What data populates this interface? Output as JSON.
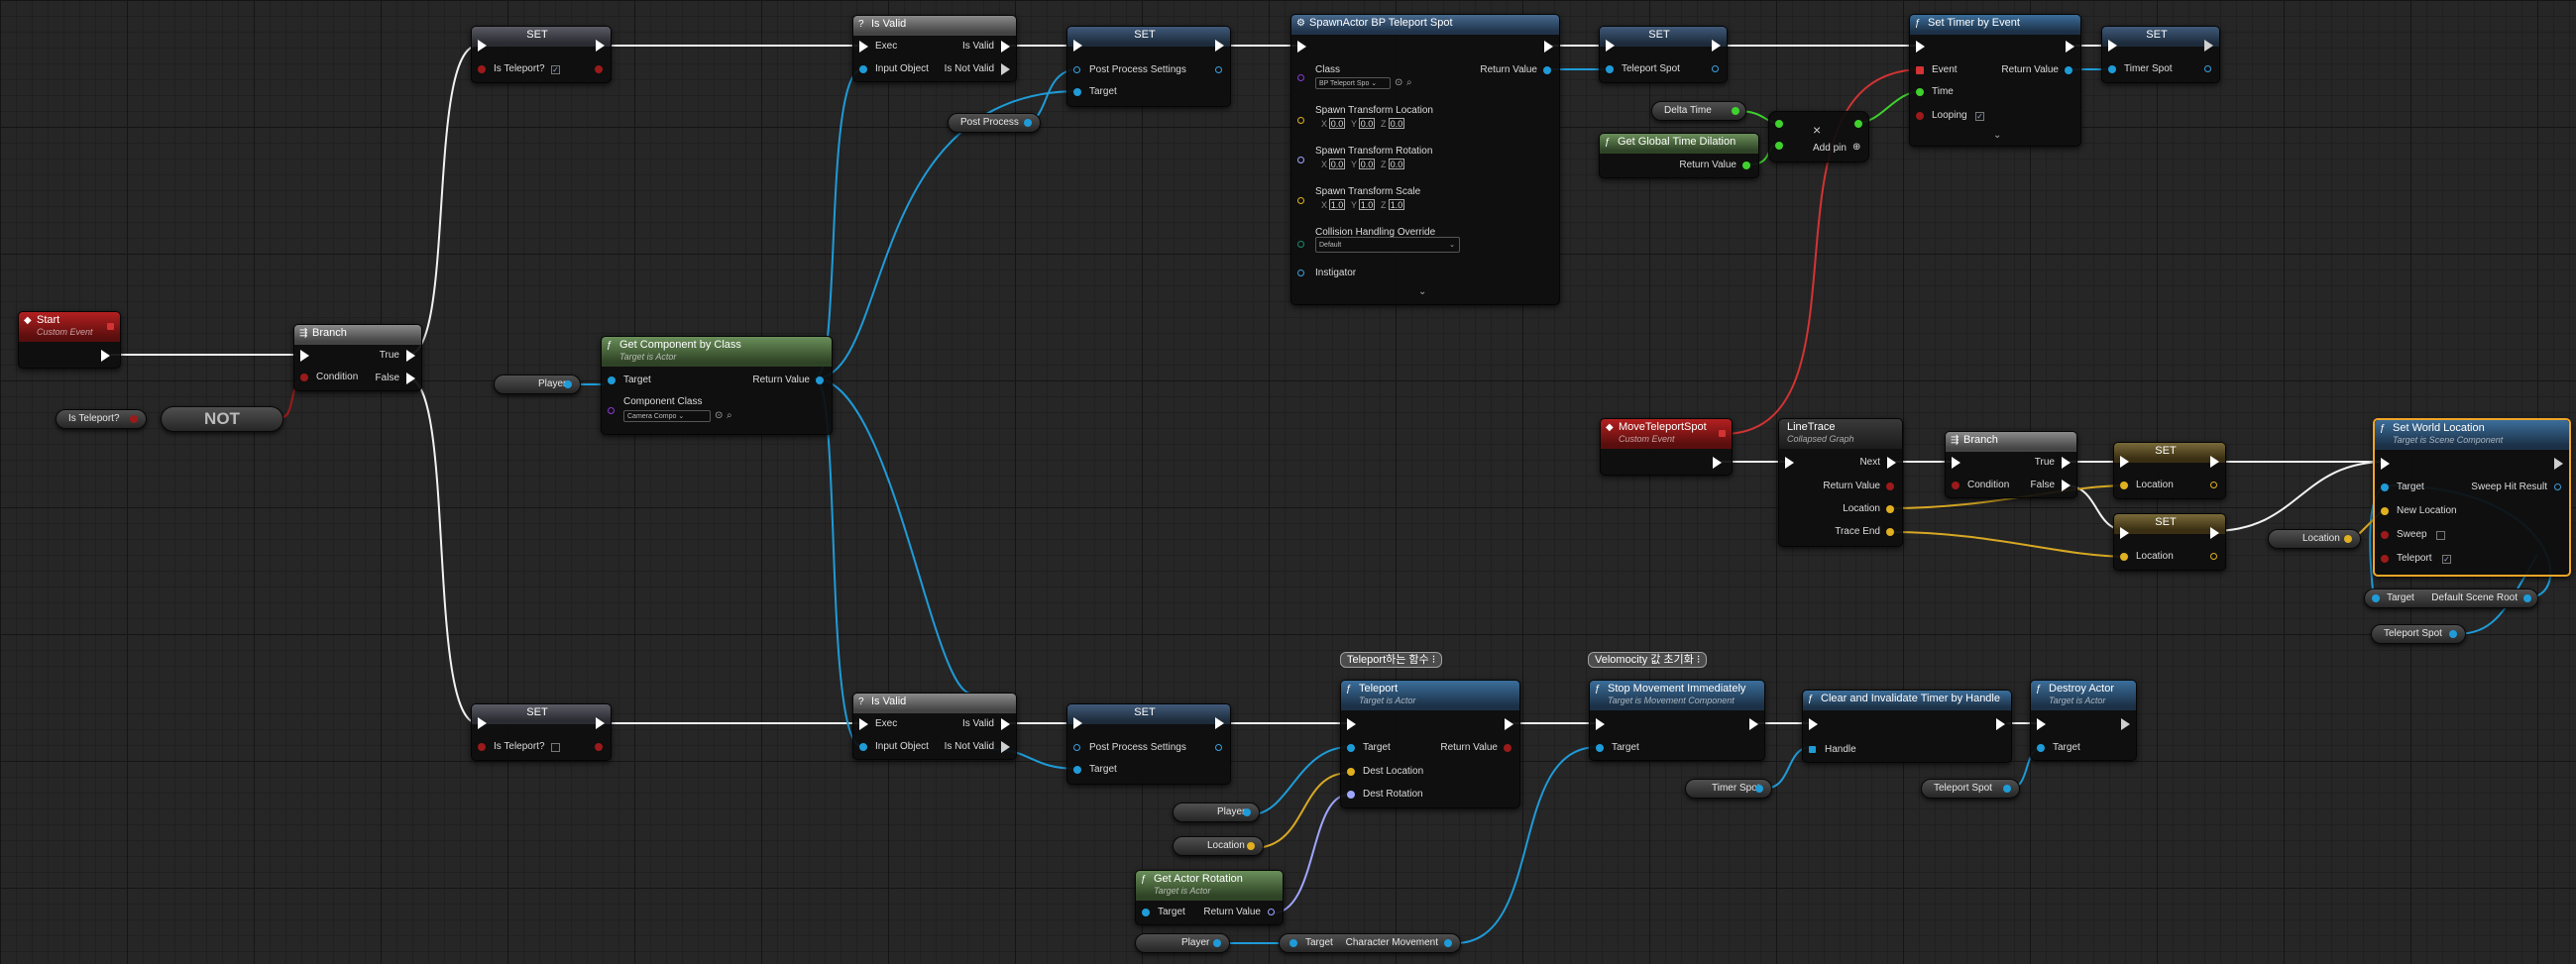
{
  "graph": {
    "start": {
      "title": "Start",
      "subtitle": "Custom Event"
    },
    "branch_top": {
      "title": "Branch",
      "true": "True",
      "condition": "Condition",
      "false": "False"
    },
    "not_node": {
      "label": "NOT"
    },
    "getters": {
      "is_teleport": "Is Teleport?",
      "player_comp": "Player",
      "post_process": "Post Process",
      "delta_time": "Delta Time",
      "player_tp": "Player",
      "location_tp": "Location",
      "player_rot": "Player",
      "timer_spot": "Timer Spot",
      "teleport_spot_destroy": "Teleport Spot",
      "location_right": "Location",
      "teleport_spot_right": "Teleport Spot"
    },
    "set_is_teleport_true": {
      "title": "SET",
      "pin": "Is Teleport?"
    },
    "set_is_teleport_false": {
      "title": "SET",
      "pin": "Is Teleport?"
    },
    "isvalid_top": {
      "title": "Is Valid",
      "exec": "Exec",
      "is_valid": "Is Valid",
      "input": "Input Object",
      "is_not_valid": "Is Not Valid"
    },
    "isvalid_bottom": {
      "title": "Is Valid",
      "exec": "Exec",
      "is_valid": "Is Valid",
      "input": "Input Object",
      "is_not_valid": "Is Not Valid"
    },
    "set_pp_top": {
      "title": "SET",
      "pps": "Post Process Settings",
      "target": "Target"
    },
    "set_pp_bottom": {
      "title": "SET",
      "pps": "Post Process Settings",
      "target": "Target"
    },
    "get_component": {
      "title": "Get Component by Class",
      "subtitle": "Target is Actor",
      "target": "Target",
      "return": "Return Value",
      "component_class": "Component Class",
      "component_value": "Camera Compo"
    },
    "spawn": {
      "title": "SpawnActor BP Teleport Spot",
      "class": "Class",
      "class_value": "BP Teleport Spo",
      "return": "Return Value",
      "loc": "Spawn Transform Location",
      "rot": "Spawn Transform Rotation",
      "scale": "Spawn Transform Scale",
      "loc_vals": [
        "0.0",
        "0.0",
        "0.0"
      ],
      "rot_vals": [
        "0.0",
        "0.0",
        "0.0"
      ],
      "scale_vals": [
        "1.0",
        "1.0",
        "1.0"
      ],
      "axes": [
        "X",
        "Y",
        "Z"
      ],
      "collision": "Collision Handling Override",
      "collision_value": "Default",
      "instigator": "Instigator"
    },
    "set_teleport_spot": {
      "title": "SET",
      "pin": "Teleport Spot"
    },
    "get_time_dilation": {
      "title": "Get Global Time Dilation",
      "return": "Return Value"
    },
    "multiply": {
      "symbol": "×",
      "add_pin": "Add pin"
    },
    "set_timer": {
      "title": "Set Timer by Event",
      "event": "Event",
      "return": "Return Value",
      "time": "Time",
      "looping": "Looping"
    },
    "set_timer_spot": {
      "title": "SET",
      "pin": "Timer Spot"
    },
    "move_event": {
      "title": "MoveTeleportSpot",
      "subtitle": "Custom Event"
    },
    "linetrace": {
      "title": "LineTrace",
      "subtitle": "Collapsed Graph",
      "next": "Next",
      "return": "Return Value",
      "location": "Location",
      "trace_end": "Trace End"
    },
    "branch_mid": {
      "title": "Branch",
      "true": "True",
      "condition": "Condition",
      "false": "False"
    },
    "set_loc_1": {
      "title": "SET",
      "pin": "Location"
    },
    "set_loc_2": {
      "title": "SET",
      "pin": "Location"
    },
    "set_world_location": {
      "title": "Set World Location",
      "subtitle": "Target is Scene Component",
      "target": "Target",
      "sweep_hit": "Sweep Hit Result",
      "new_location": "New Location",
      "sweep": "Sweep",
      "teleport": "Teleport"
    },
    "default_scene_root": {
      "target": "Target",
      "label": "Default Scene Root"
    },
    "comments": {
      "teleport": "Teleport하는 함수",
      "velocity": "Velomocity 값 초기화"
    },
    "teleport": {
      "title": "Teleport",
      "subtitle": "Target is Actor",
      "target": "Target",
      "return": "Return Value",
      "dest_loc": "Dest Location",
      "dest_rot": "Dest Rotation"
    },
    "stop_movement": {
      "title": "Stop Movement Immediately",
      "subtitle": "Target is Movement Component",
      "target": "Target"
    },
    "clear_timer": {
      "title": "Clear and Invalidate Timer by Handle",
      "handle": "Handle"
    },
    "destroy": {
      "title": "Destroy Actor",
      "subtitle": "Target is Actor",
      "target": "Target"
    },
    "get_actor_rotation": {
      "title": "Get Actor Rotation",
      "subtitle": "Target is Actor",
      "target": "Target",
      "return": "Return Value"
    },
    "char_movement": {
      "target": "Target",
      "label": "Character Movement"
    }
  },
  "colors": {
    "exec": "#ffffff",
    "bool": "#9c1a1a",
    "object": "#1f9bd8",
    "struct": "#e0b020",
    "float": "#3fd12e",
    "rotator": "#9fa6ff",
    "delegate": "#d33333",
    "selected": "#f0a526"
  }
}
